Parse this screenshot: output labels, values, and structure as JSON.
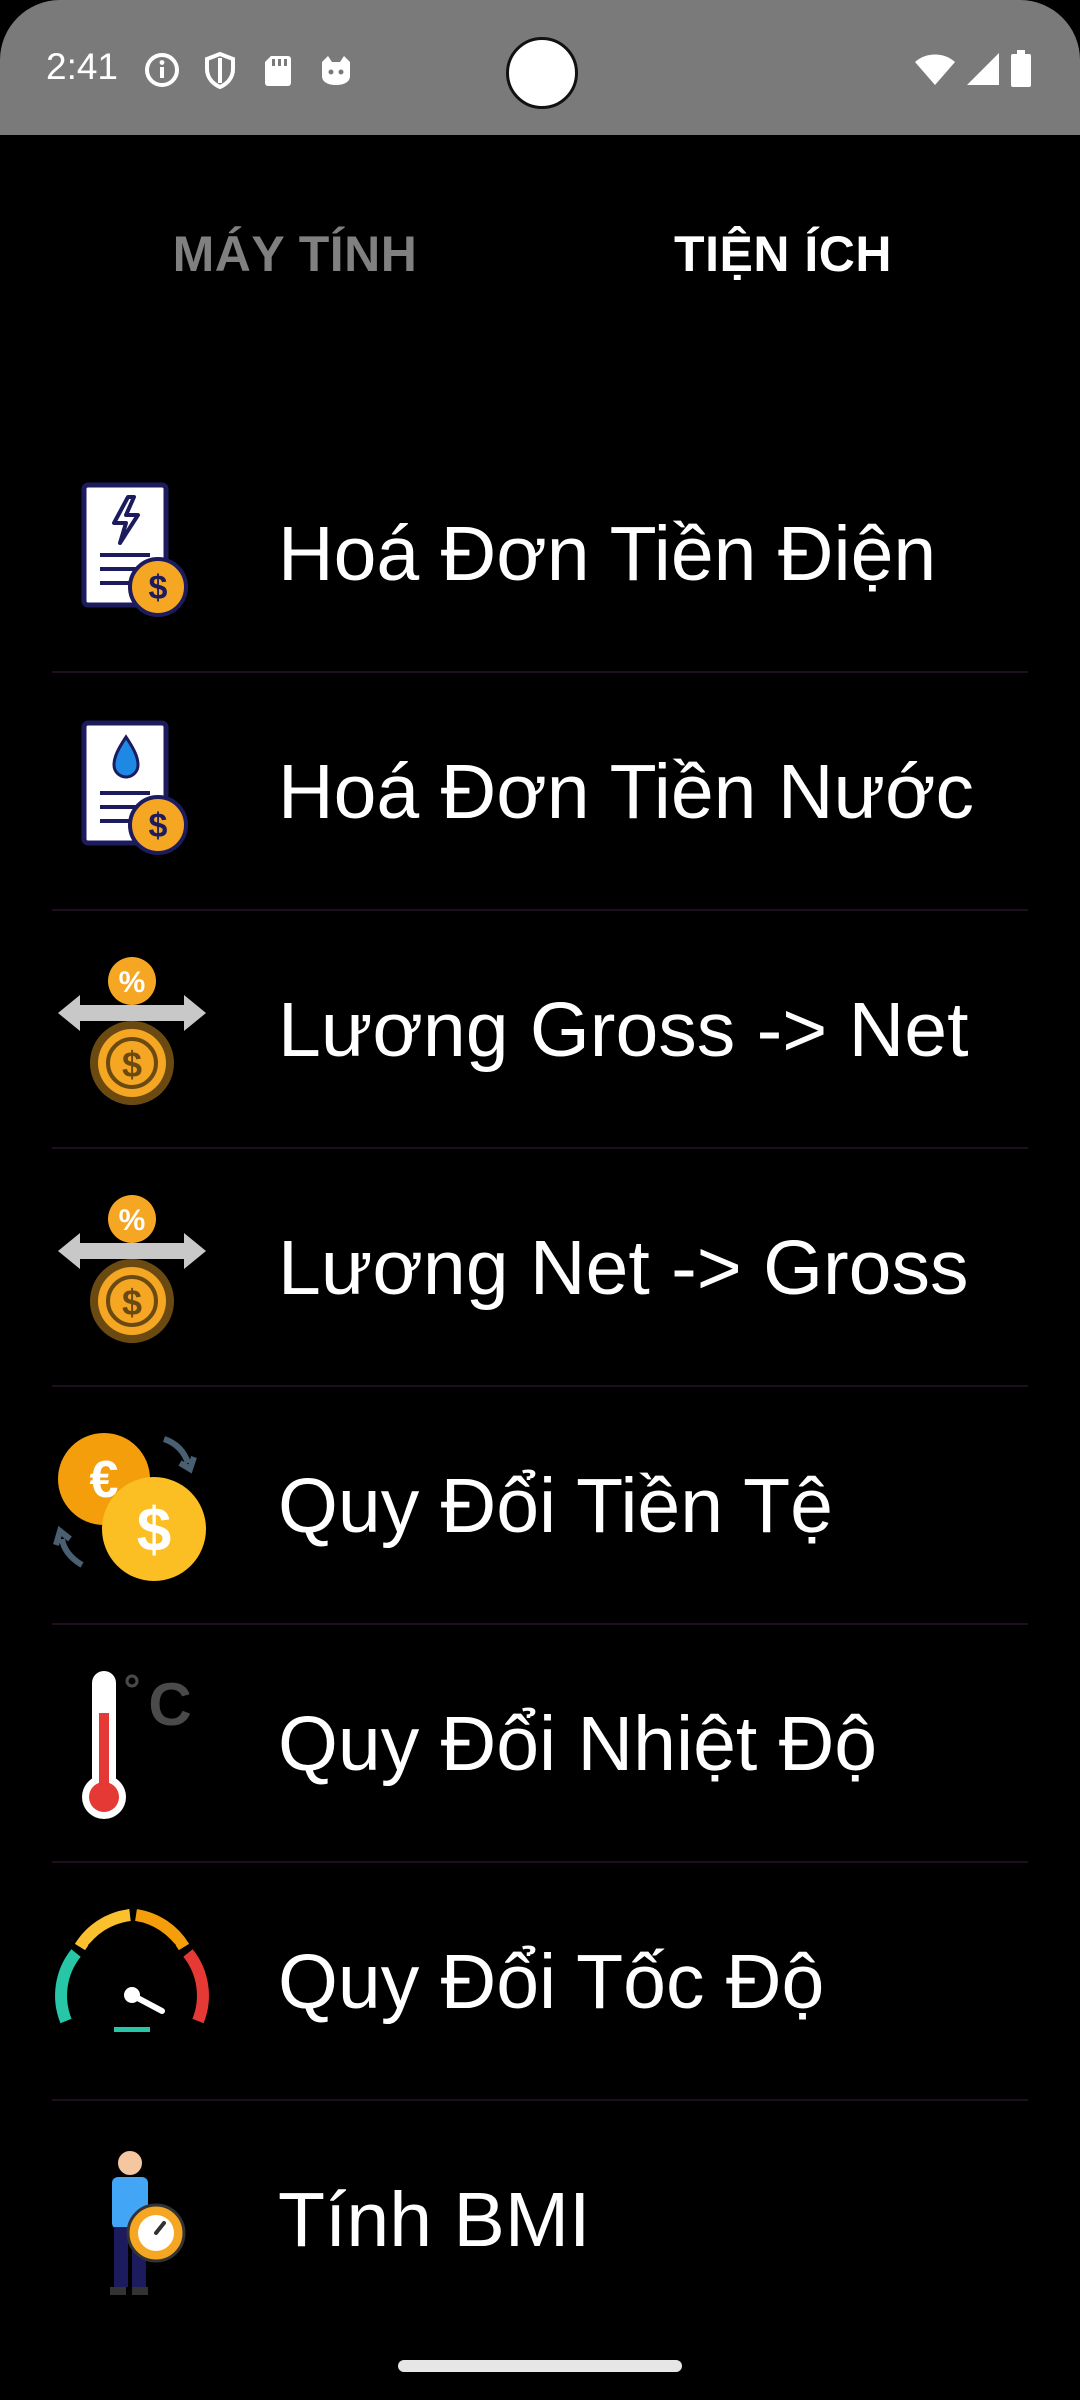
{
  "status": {
    "time": "2:41",
    "left_icons": [
      "info-icon",
      "shield-icon",
      "sd-card-icon",
      "cat-icon"
    ],
    "right_icons": [
      "wifi-icon",
      "signal-icon",
      "battery-icon"
    ]
  },
  "tabs": [
    {
      "label": "MÁY TÍNH",
      "selected": false
    },
    {
      "label": "TIỆN ÍCH",
      "selected": true
    }
  ],
  "items": [
    {
      "label": "Hoá Đơn Tiền Điện",
      "icon": "electric-bill-icon"
    },
    {
      "label": "Hoá Đơn Tiền Nước",
      "icon": "water-bill-icon"
    },
    {
      "label": "Lương Gross -> Net",
      "icon": "salary-gross-net-icon"
    },
    {
      "label": "Lương Net -> Gross",
      "icon": "salary-net-gross-icon"
    },
    {
      "label": "Quy Đổi Tiền Tệ",
      "icon": "currency-exchange-icon"
    },
    {
      "label": "Quy Đổi Nhiệt Độ",
      "icon": "thermometer-icon"
    },
    {
      "label": "Quy Đổi Tốc Độ",
      "icon": "speedometer-icon"
    },
    {
      "label": "Tính BMI",
      "icon": "bmi-person-icon"
    }
  ],
  "colors": {
    "status_bar": "#7a7a7a",
    "background": "#000000",
    "tab_selected": "#ffffff",
    "tab_unselected": "#808080",
    "coin": "#f5a623"
  }
}
